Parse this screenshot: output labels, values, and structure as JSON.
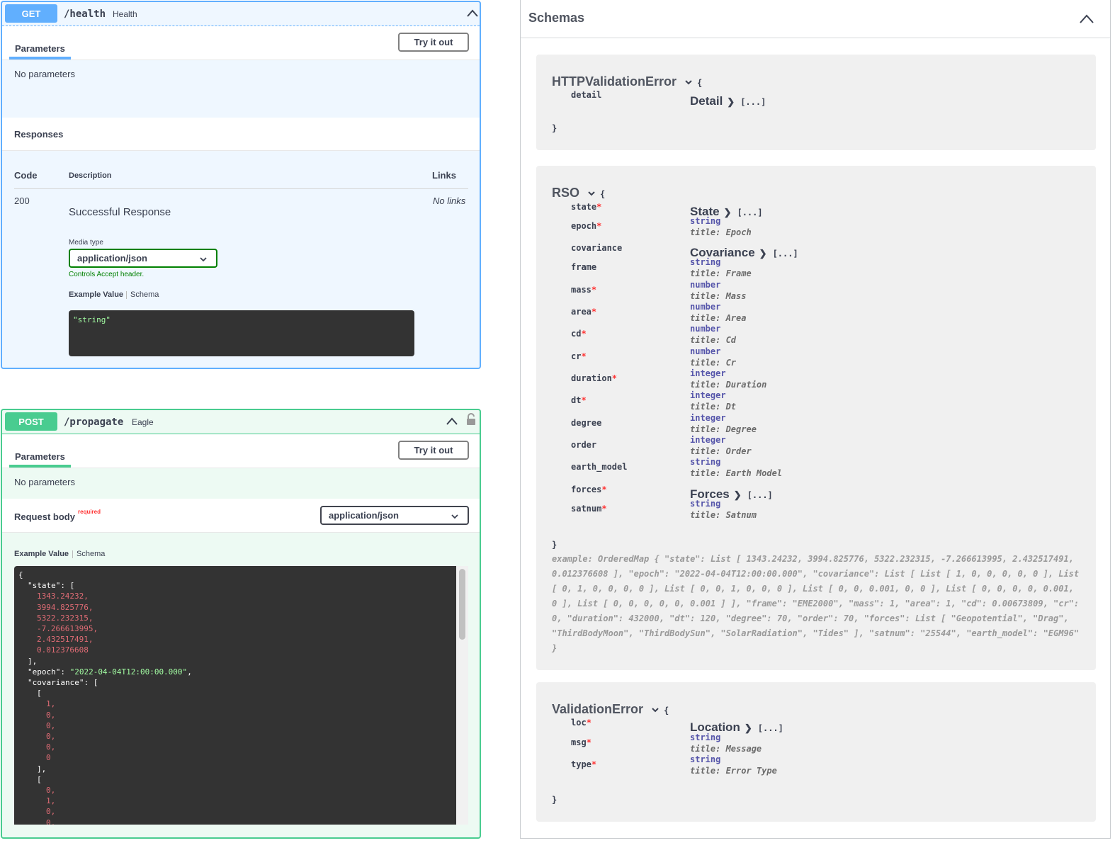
{
  "get_op": {
    "method": "GET",
    "path": "/health",
    "description": "Health",
    "parameters_tab": "Parameters",
    "try_button": "Try it out",
    "no_parameters": "No parameters",
    "responses_heading": "Responses",
    "col_code": "Code",
    "col_description": "Description",
    "col_links": "Links",
    "response_code": "200",
    "response_description": "Successful Response",
    "no_links": "No links",
    "media_type_label": "Media type",
    "media_type_value": "application/json",
    "controls_accept": "Controls Accept header.",
    "example_value_tab": "Example Value",
    "schema_tab": "Schema",
    "example_value": "\"string\""
  },
  "post_op": {
    "method": "POST",
    "path": "/propagate",
    "description": "Eagle",
    "parameters_tab": "Parameters",
    "try_button": "Try it out",
    "no_parameters": "No parameters",
    "request_body_label": "Request body",
    "required_label": "required",
    "content_type": "application/json",
    "example_value_tab": "Example Value",
    "schema_tab": "Schema",
    "code_lines": [
      {
        "text": "{",
        "cls": "",
        "indent": 0
      },
      {
        "text": "\"state\": [",
        "cls": "",
        "indent": 1
      },
      {
        "text": "1343.24232,",
        "cls": "num",
        "indent": 2
      },
      {
        "text": "3994.825776,",
        "cls": "num",
        "indent": 2
      },
      {
        "text": "5322.232315,",
        "cls": "num",
        "indent": 2
      },
      {
        "text": "-7.266613995,",
        "cls": "num",
        "indent": 2
      },
      {
        "text": "2.432517491,",
        "cls": "num",
        "indent": 2
      },
      {
        "text": "0.012376608",
        "cls": "num",
        "indent": 2
      },
      {
        "text": "],",
        "cls": "",
        "indent": 1
      },
      {
        "text": "\"epoch\": ",
        "cls": "",
        "indent": 1,
        "str": "\"2022-04-04T12:00:00.000\"",
        "tail": ","
      },
      {
        "text": "\"covariance\": [",
        "cls": "",
        "indent": 1
      },
      {
        "text": "[",
        "cls": "",
        "indent": 2
      },
      {
        "text": "1,",
        "cls": "num",
        "indent": 3
      },
      {
        "text": "0,",
        "cls": "num",
        "indent": 3
      },
      {
        "text": "0,",
        "cls": "num",
        "indent": 3
      },
      {
        "text": "0,",
        "cls": "num",
        "indent": 3
      },
      {
        "text": "0,",
        "cls": "num",
        "indent": 3
      },
      {
        "text": "0",
        "cls": "num",
        "indent": 3
      },
      {
        "text": "],",
        "cls": "",
        "indent": 2
      },
      {
        "text": "[",
        "cls": "",
        "indent": 2
      },
      {
        "text": "0,",
        "cls": "num",
        "indent": 3
      },
      {
        "text": "1,",
        "cls": "num",
        "indent": 3
      },
      {
        "text": "0,",
        "cls": "num",
        "indent": 3
      },
      {
        "text": "0,",
        "cls": "num",
        "indent": 3
      }
    ]
  },
  "schemas": {
    "title": "Schemas",
    "http_validation_error": {
      "name": "HTTPValidationError",
      "open_brace": "{",
      "close_brace": "}",
      "prop": "detail",
      "ref": "Detail",
      "dots": "[...]"
    },
    "rso": {
      "name": "RSO",
      "open_brace": "{",
      "close_brace": "}",
      "properties": [
        {
          "name": "state",
          "required": "*",
          "ref": "State",
          "dots": "[...]"
        },
        {
          "name": "epoch",
          "required": "*",
          "type": "string",
          "title": "title: Epoch"
        },
        {
          "name": "covariance",
          "required": "",
          "ref": "Covariance",
          "dots": "[...]"
        },
        {
          "name": "frame",
          "required": "",
          "type": "string",
          "title": "title: Frame"
        },
        {
          "name": "mass",
          "required": "*",
          "type": "number",
          "title": "title: Mass"
        },
        {
          "name": "area",
          "required": "*",
          "type": "number",
          "title": "title: Area"
        },
        {
          "name": "cd",
          "required": "*",
          "type": "number",
          "title": "title: Cd"
        },
        {
          "name": "cr",
          "required": "*",
          "type": "number",
          "title": "title: Cr"
        },
        {
          "name": "duration",
          "required": "*",
          "type": "integer",
          "title": "title: Duration"
        },
        {
          "name": "dt",
          "required": "*",
          "type": "integer",
          "title": "title: Dt"
        },
        {
          "name": "degree",
          "required": "",
          "type": "integer",
          "title": "title: Degree"
        },
        {
          "name": "order",
          "required": "",
          "type": "integer",
          "title": "title: Order"
        },
        {
          "name": "earth_model",
          "required": "",
          "type": "string",
          "title": "title: Earth Model"
        },
        {
          "name": "forces",
          "required": "*",
          "ref": "Forces",
          "dots": "[...]"
        },
        {
          "name": "satnum",
          "required": "*",
          "type": "string",
          "title": "title: Satnum"
        }
      ],
      "example": "example: OrderedMap { \"state\": List [ 1343.24232, 3994.825776, 5322.232315, -7.266613995, 2.432517491, 0.012376608 ], \"epoch\": \"2022-04-04T12:00:00.000\", \"covariance\": List [ List [ 1, 0, 0, 0, 0, 0 ], List [ 0, 1, 0, 0, 0, 0 ], List [ 0, 0, 1, 0, 0, 0 ], List [ 0, 0, 0.001, 0, 0 ], List [ 0, 0, 0, 0, 0.001, 0 ], List [ 0, 0, 0, 0, 0, 0.001 ] ], \"frame\": \"EME2000\", \"mass\": 1, \"area\": 1, \"cd\": 0.00673809, \"cr\": 0, \"duration\": 432000, \"dt\": 120, \"degree\": 70, \"order\": 70, \"forces\": List [ \"Geopotential\", \"Drag\", \"ThirdBodyMoon\", \"ThirdBodySun\", \"SolarRadiation\", \"Tides\" ], \"satnum\": \"25544\", \"earth_model\": \"EGM96\" }"
    },
    "validation_error": {
      "name": "ValidationError",
      "open_brace": "{",
      "close_brace": "}",
      "properties": [
        {
          "name": "loc",
          "required": "*",
          "ref": "Location",
          "dots": "[...]"
        },
        {
          "name": "msg",
          "required": "*",
          "type": "string",
          "title": "title: Message"
        },
        {
          "name": "type",
          "required": "*",
          "type": "string",
          "title": "title: Error Type"
        }
      ]
    }
  },
  "colors": {
    "get": "#61affe",
    "post": "#49cc90",
    "required": "#ff3333",
    "type": "#5555aa"
  }
}
